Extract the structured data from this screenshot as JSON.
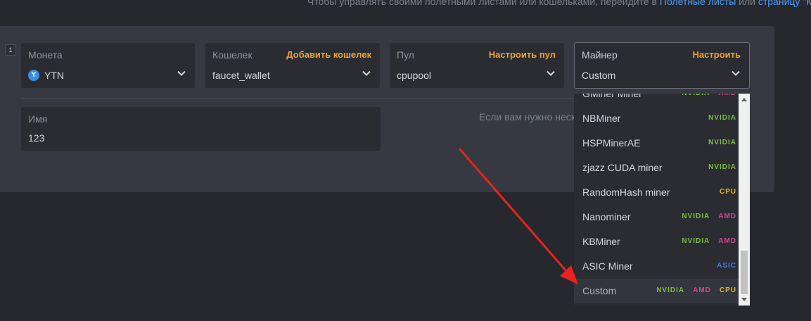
{
  "top_hint": {
    "text": "Чтобы управлять своими полетными листами или кошельками, перейдите в ",
    "link1": "Полетные листы",
    "mid": " или ",
    "link2": "страницу \"Кош"
  },
  "row_number": "1",
  "coin": {
    "label": "Монета",
    "value": "YTN",
    "icon": "ytn-coin-icon"
  },
  "wallet": {
    "label": "Кошелек",
    "action": "Добавить кошелек",
    "value": "faucet_wallet"
  },
  "pool": {
    "label": "Пул",
    "action": "Настроить пул",
    "value": "cpupool"
  },
  "miner": {
    "label": "Майнер",
    "action": "Настроить",
    "value": "Custom"
  },
  "name_field": {
    "label": "Имя",
    "value": "123"
  },
  "right_hint": "Если вам нужно неско",
  "colors": {
    "accent_orange": "#f0a32c",
    "link_blue": "#4f9bef",
    "nvidia": "#7cbf3f",
    "amd": "#d1468f",
    "cpu": "#e8b825",
    "asic": "#4a78e8",
    "arrow": "#e8231f"
  },
  "miner_options": [
    {
      "name": "GMiner Miner",
      "tags": [
        "NVIDIA",
        "AMD"
      ]
    },
    {
      "name": "NBMiner",
      "tags": [
        "NVIDIA"
      ]
    },
    {
      "name": "HSPMinerAE",
      "tags": [
        "NVIDIA"
      ]
    },
    {
      "name": "zjazz CUDA miner",
      "tags": [
        "NVIDIA"
      ]
    },
    {
      "name": "RandomHash miner",
      "tags": [
        "CPU"
      ]
    },
    {
      "name": "Nanominer",
      "tags": [
        "NVIDIA",
        "AMD"
      ]
    },
    {
      "name": "KBMiner",
      "tags": [
        "NVIDIA",
        "AMD"
      ]
    },
    {
      "name": "ASIC Miner",
      "tags": [
        "ASIC"
      ]
    },
    {
      "name": "Custom",
      "tags": [
        "NVIDIA",
        "AMD",
        "CPU"
      ],
      "selected": true
    }
  ]
}
